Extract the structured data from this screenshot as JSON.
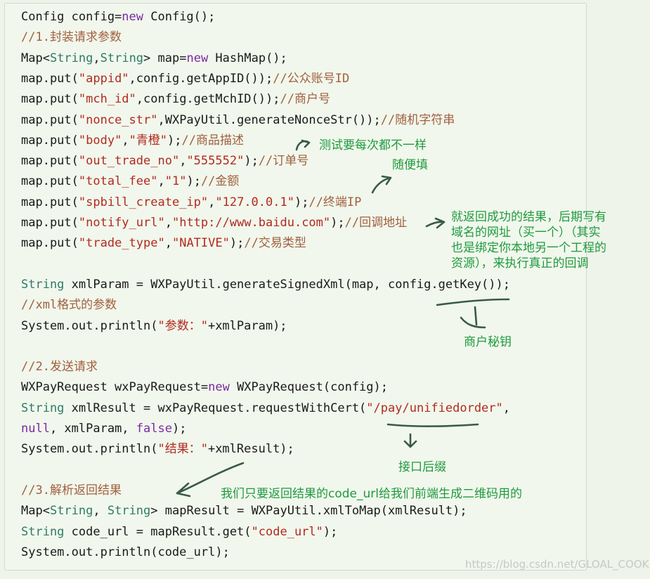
{
  "code": {
    "lines": [
      [
        {
          "t": "Config config=",
          "c": ""
        },
        {
          "t": "new",
          "c": "kw"
        },
        {
          "t": " Config();",
          "c": ""
        }
      ],
      [
        {
          "t": "//1.封装请求参数",
          "c": "cm"
        }
      ],
      [
        {
          "t": "Map<",
          "c": ""
        },
        {
          "t": "String",
          "c": "ty"
        },
        {
          "t": ",",
          "c": ""
        },
        {
          "t": "String",
          "c": "ty"
        },
        {
          "t": "> map=",
          "c": ""
        },
        {
          "t": "new",
          "c": "kw"
        },
        {
          "t": " HashMap();",
          "c": ""
        }
      ],
      [
        {
          "t": "map.put(",
          "c": ""
        },
        {
          "t": "\"appid\"",
          "c": "str"
        },
        {
          "t": ",config.getAppID());",
          "c": ""
        },
        {
          "t": "//公众账号ID",
          "c": "cm"
        }
      ],
      [
        {
          "t": "map.put(",
          "c": ""
        },
        {
          "t": "\"mch_id\"",
          "c": "str"
        },
        {
          "t": ",config.getMchID());",
          "c": ""
        },
        {
          "t": "//商户号",
          "c": "cm"
        }
      ],
      [
        {
          "t": "map.put(",
          "c": ""
        },
        {
          "t": "\"nonce_str\"",
          "c": "str"
        },
        {
          "t": ",WXPayUtil.generateNonceStr());",
          "c": ""
        },
        {
          "t": "//随机字符串",
          "c": "cm"
        }
      ],
      [
        {
          "t": "map.put(",
          "c": ""
        },
        {
          "t": "\"body\"",
          "c": "str"
        },
        {
          "t": ",",
          "c": ""
        },
        {
          "t": "\"青橙\"",
          "c": "str"
        },
        {
          "t": ");",
          "c": ""
        },
        {
          "t": "//商品描述",
          "c": "cm"
        }
      ],
      [
        {
          "t": "map.put(",
          "c": ""
        },
        {
          "t": "\"out_trade_no\"",
          "c": "str"
        },
        {
          "t": ",",
          "c": ""
        },
        {
          "t": "\"555552\"",
          "c": "str"
        },
        {
          "t": ");",
          "c": ""
        },
        {
          "t": "//订单号",
          "c": "cm"
        }
      ],
      [
        {
          "t": "map.put(",
          "c": ""
        },
        {
          "t": "\"total_fee\"",
          "c": "str"
        },
        {
          "t": ",",
          "c": ""
        },
        {
          "t": "\"1\"",
          "c": "str"
        },
        {
          "t": ");",
          "c": ""
        },
        {
          "t": "//金额",
          "c": "cm"
        }
      ],
      [
        {
          "t": "map.put(",
          "c": ""
        },
        {
          "t": "\"spbill_create_ip\"",
          "c": "str"
        },
        {
          "t": ",",
          "c": ""
        },
        {
          "t": "\"127.0.0.1\"",
          "c": "str"
        },
        {
          "t": ");",
          "c": ""
        },
        {
          "t": "//终端IP",
          "c": "cm"
        }
      ],
      [
        {
          "t": "map.put(",
          "c": ""
        },
        {
          "t": "\"notify_url\"",
          "c": "str"
        },
        {
          "t": ",",
          "c": ""
        },
        {
          "t": "\"http://www.baidu.com\"",
          "c": "str"
        },
        {
          "t": ");",
          "c": ""
        },
        {
          "t": "//回调地址",
          "c": "cm"
        }
      ],
      [
        {
          "t": "map.put(",
          "c": ""
        },
        {
          "t": "\"trade_type\"",
          "c": "str"
        },
        {
          "t": ",",
          "c": ""
        },
        {
          "t": "\"NATIVE\"",
          "c": "str"
        },
        {
          "t": ");",
          "c": ""
        },
        {
          "t": "//交易类型",
          "c": "cm"
        }
      ],
      [],
      [
        {
          "t": "String",
          "c": "ty"
        },
        {
          "t": " xmlParam = WXPayUtil.generateSignedXml(map, config.getKey());",
          "c": ""
        }
      ],
      [
        {
          "t": "//xml格式的参数",
          "c": "cm"
        }
      ],
      [
        {
          "t": "System.out.println(",
          "c": ""
        },
        {
          "t": "\"参数：\"",
          "c": "str"
        },
        {
          "t": "+xmlParam);",
          "c": ""
        }
      ],
      [],
      [
        {
          "t": "//2.发送请求",
          "c": "cm"
        }
      ],
      [
        {
          "t": "WXPayRequest wxPayRequest=",
          "c": ""
        },
        {
          "t": "new",
          "c": "kw"
        },
        {
          "t": " WXPayRequest(config);",
          "c": ""
        }
      ],
      [
        {
          "t": "String",
          "c": "ty"
        },
        {
          "t": " xmlResult = wxPayRequest.requestWithCert(",
          "c": ""
        },
        {
          "t": "\"/pay/unifiedorder\"",
          "c": "str"
        },
        {
          "t": ",",
          "c": ""
        }
      ],
      [
        {
          "t": "null",
          "c": "kw"
        },
        {
          "t": ", xmlParam, ",
          "c": ""
        },
        {
          "t": "false",
          "c": "kw"
        },
        {
          "t": ");",
          "c": ""
        }
      ],
      [
        {
          "t": "System.out.println(",
          "c": ""
        },
        {
          "t": "\"结果：\"",
          "c": "str"
        },
        {
          "t": "+xmlResult);",
          "c": ""
        }
      ],
      [],
      [
        {
          "t": "//3.解析返回结果",
          "c": "cm"
        }
      ],
      [
        {
          "t": "Map<",
          "c": ""
        },
        {
          "t": "String",
          "c": "ty"
        },
        {
          "t": ", ",
          "c": ""
        },
        {
          "t": "String",
          "c": "ty"
        },
        {
          "t": "> mapResult = WXPayUtil.xmlToMap(xmlResult);",
          "c": ""
        }
      ],
      [
        {
          "t": "String",
          "c": "ty"
        },
        {
          "t": " code_url = mapResult.get(",
          "c": ""
        },
        {
          "t": "\"code_url\"",
          "c": "str"
        },
        {
          "t": ");",
          "c": ""
        }
      ],
      [
        {
          "t": "System.out.println(code_url);",
          "c": ""
        }
      ]
    ]
  },
  "annotations": {
    "test_vary": "测试要每次都不一样",
    "fill_any": "随便填",
    "callback_note": "就返回成功的结果，后期写有\n域名的网址（买一个）（其实\n也是绑定你本地另一个工程的\n资源），来执行真正的回调",
    "merchant_key": "商户秘钥",
    "endpoint_suffix": "接口后缀",
    "code_url_note": "我们只要返回结果的code_url给我们前端生成二维码用的"
  },
  "watermark": "https://blog.csdn.net/GLOAL_COOK",
  "colors": {
    "keyword": "#7b2aa3",
    "type": "#2f7a6b",
    "string": "#b22a1f",
    "comment": "#a1603f",
    "annotation": "#1f9a3f",
    "ink": "#3a5a48"
  }
}
